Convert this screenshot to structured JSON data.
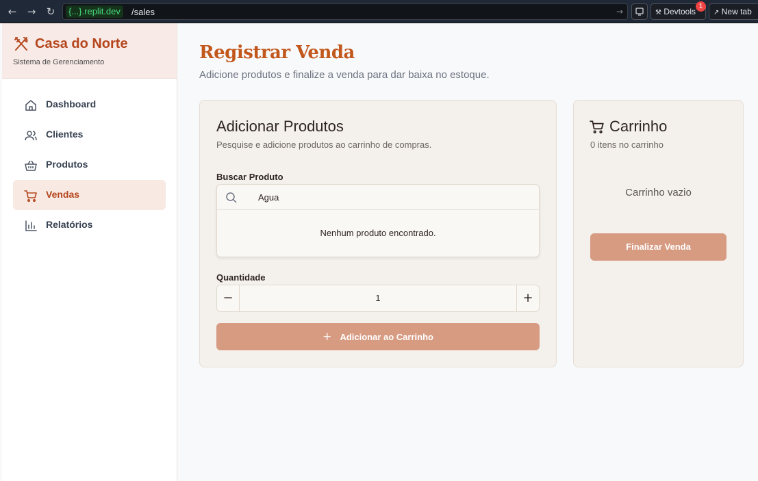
{
  "browser": {
    "url_domain": "{...}.replit.dev",
    "url_path": "/sales",
    "devtools_label": "Devtools",
    "devtools_badge": "1",
    "new_tab_label": "New tab"
  },
  "sidebar": {
    "brand_title": "Casa do Norte",
    "brand_subtitle": "Sistema de Gerenciamento",
    "items": [
      {
        "label": "Dashboard",
        "icon": "home-icon",
        "active": false
      },
      {
        "label": "Clientes",
        "icon": "users-icon",
        "active": false
      },
      {
        "label": "Produtos",
        "icon": "basket-icon",
        "active": false
      },
      {
        "label": "Vendas",
        "icon": "cart-icon",
        "active": true
      },
      {
        "label": "Relatórios",
        "icon": "bar-chart-icon",
        "active": false
      }
    ]
  },
  "page": {
    "title": "Registrar Venda",
    "subtitle": "Adicione produtos e finalize a venda para dar baixa no estoque."
  },
  "add_products": {
    "title": "Adicionar Produtos",
    "subtitle": "Pesquise e adicione produtos ao carrinho de compras.",
    "search_label": "Buscar Produto",
    "search_value": "Agua",
    "search_empty": "Nenhum produto encontrado.",
    "quantity_label": "Quantidade",
    "quantity_value": "1",
    "minus_symbol": "−",
    "plus_symbol": "+",
    "add_button": "Adicionar ao Carrinho"
  },
  "cart": {
    "title": "Carrinho",
    "count_text": "0 itens no carrinho",
    "empty_text": "Carrinho vazio",
    "finalize_button": "Finalizar Venda"
  },
  "colors": {
    "accent": "#b4451c",
    "button": "#d79b82",
    "active_bg": "#f8e9e3"
  }
}
